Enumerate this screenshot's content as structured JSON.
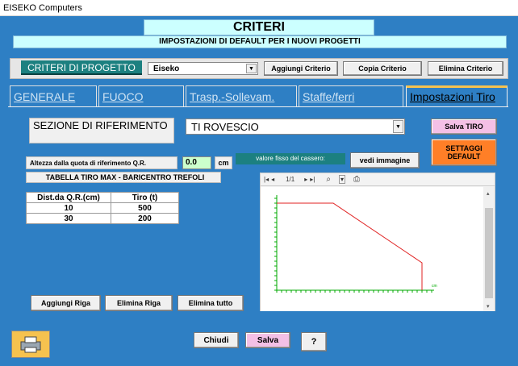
{
  "window": {
    "title": "EISEKO Computers"
  },
  "header": {
    "title": "CRITERI",
    "subtitle": "IMPOSTAZIONI DI DEFAULT PER I NUOVI PROGETTI"
  },
  "criteria_bar": {
    "label": "CRITERI DI PROGETTO",
    "selected": "Eiseko",
    "add_label": "Aggiungi Criterio",
    "copy_label": "Copia Criterio",
    "delete_label": "Elimina Criterio"
  },
  "tabs": [
    {
      "label": "GENERALE"
    },
    {
      "label": "FUOCO"
    },
    {
      "label": "Trasp.-Sollevam."
    },
    {
      "label": "Staffe/ferri"
    },
    {
      "label": "Impostazioni Tiro"
    }
  ],
  "tiro": {
    "sezione_label": "SEZIONE DI RIFERIMENTO",
    "sezione_value": "TI ROVESCIO",
    "salva_tiro": "Salva TIRO",
    "settaggi_default": "SETTAGGI DEFAULT",
    "altezza_label": "Altezza dalla quota di riferimento Q.R.",
    "altezza_value": "0.0",
    "altezza_unit": "cm",
    "cassero_label": "valore fisso del cassero:",
    "vedi_immagine": "vedi immagine",
    "tabella_title": "TABELLA TIRO MAX - BARICENTRO TREFOLI",
    "table_headers": [
      "Dist.da Q.R.(cm)",
      "Tiro (t)"
    ],
    "rows": [
      [
        "10",
        "500"
      ],
      [
        "30",
        "200"
      ]
    ],
    "aggiungi_riga": "Aggiungi Riga",
    "elimina_riga": "Elimina Riga",
    "elimina_tutto": "Elimina tutto"
  },
  "viewer": {
    "page": "1/1"
  },
  "footer": {
    "chiudi": "Chiudi",
    "salva": "Salva",
    "help": "?"
  },
  "colors": {
    "background": "#2e7fc4",
    "header_box": "#ccffff",
    "settaggi": "#ff7f27",
    "salva": "#f4c0e6",
    "line": "#ff0000"
  }
}
